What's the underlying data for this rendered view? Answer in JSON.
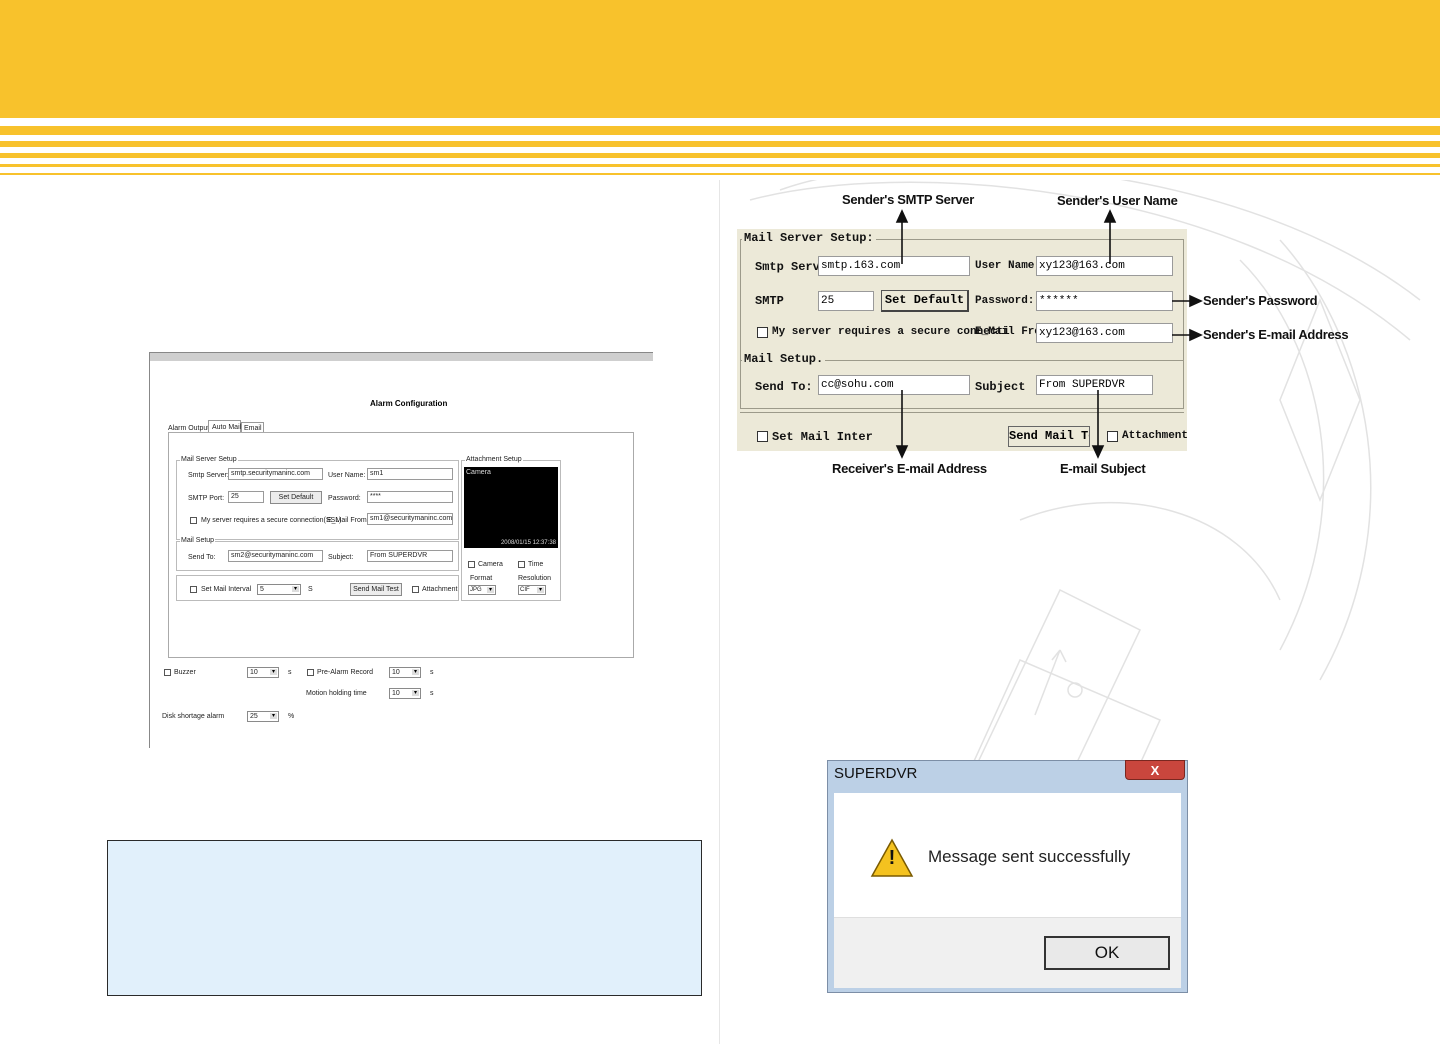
{
  "alarm_config": {
    "title": "Alarm Configuration",
    "tabs": [
      "Alarm Output",
      "Auto Mail",
      "Email"
    ],
    "mail_server_setup": {
      "group_label": "Mail Server Setup",
      "smtp_server_label": "Smtp Server:",
      "smtp_server_value": "smtp.securitymaninc.com",
      "user_name_label": "User Name:",
      "user_name_value": "sm1",
      "smtp_port_label": "SMTP Port:",
      "smtp_port_value": "25",
      "set_default_label": "Set Default",
      "password_label": "Password:",
      "password_value": "****",
      "ssl_label": "My server requires a secure connection(SSL)",
      "email_from_label": "E_Mail From:",
      "email_from_value": "sm1@securitymaninc.com"
    },
    "mail_setup": {
      "group_label": "Mail Setup",
      "send_to_label": "Send To:",
      "send_to_value": "sm2@securitymaninc.com",
      "subject_label": "Subject:",
      "subject_value": "From SUPERDVR"
    },
    "set_mail_interval_label": "Set Mail Interval",
    "set_mail_interval_value": "5",
    "interval_unit": "S",
    "send_mail_test_label": "Send Mail Test",
    "attachment_label": "Attachment",
    "attachment_setup": {
      "group_label": "Attachment Setup",
      "camera_label": "Camera",
      "timestamp": "2008/01/15 12:37:38",
      "camera_check_label": "Camera",
      "time_check_label": "Time",
      "format_label": "Format",
      "format_value": "JPG",
      "resolution_label": "Resolution",
      "resolution_value": "CIF"
    },
    "buzzer_label": "Buzzer",
    "buzzer_value": "10",
    "buzzer_unit": "s",
    "pre_alarm_label": "Pre-Alarm Record",
    "pre_alarm_value": "10",
    "pre_alarm_unit": "s",
    "motion_label": "Motion holding time",
    "motion_value": "10",
    "motion_unit": "s",
    "disk_label": "Disk shortage alarm",
    "disk_value": "25",
    "disk_unit": "%"
  },
  "mail_server_detail": {
    "server_setup_label": "Mail Server Setup:",
    "smtp_server_label": "Smtp Server",
    "smtp_server_value": "smtp.163.com",
    "user_name_label": "User Name:",
    "user_name_value": "xy123@163.com",
    "smtp_label": "SMTP",
    "smtp_value": "25",
    "set_default_label": "Set Default",
    "password_label": "Password:",
    "password_value": "******",
    "ssl_label": "My server requires a secure connecti",
    "email_from_label": "E_Mail From",
    "email_from_value": "xy123@163.com",
    "mail_setup_label": "Mail Setup.",
    "send_to_label": "Send To:",
    "send_to_value": "cc@sohu.com",
    "subject_label": "Subject",
    "subject_value": "From SUPERDVR",
    "set_mail_label": "Set Mail Inter",
    "send_mail_test_label": "Send Mail Test",
    "attachment_label": "Attachment",
    "callouts": {
      "smtp_server": "Sender's SMTP Server",
      "user_name": "Sender's User Name",
      "password": "Sender's Password",
      "email_address": "Sender's E-mail Address",
      "receiver": "Receiver's E-mail Address",
      "subject": "E-mail Subject"
    }
  },
  "dialog": {
    "title": "SUPERDVR",
    "close_glyph": "X",
    "message": "Message sent successfully",
    "ok_label": "OK",
    "warning_glyph": "!"
  },
  "colors": {
    "header_yellow": "#f8c22c",
    "note_box_bg": "#e1f0fb"
  }
}
